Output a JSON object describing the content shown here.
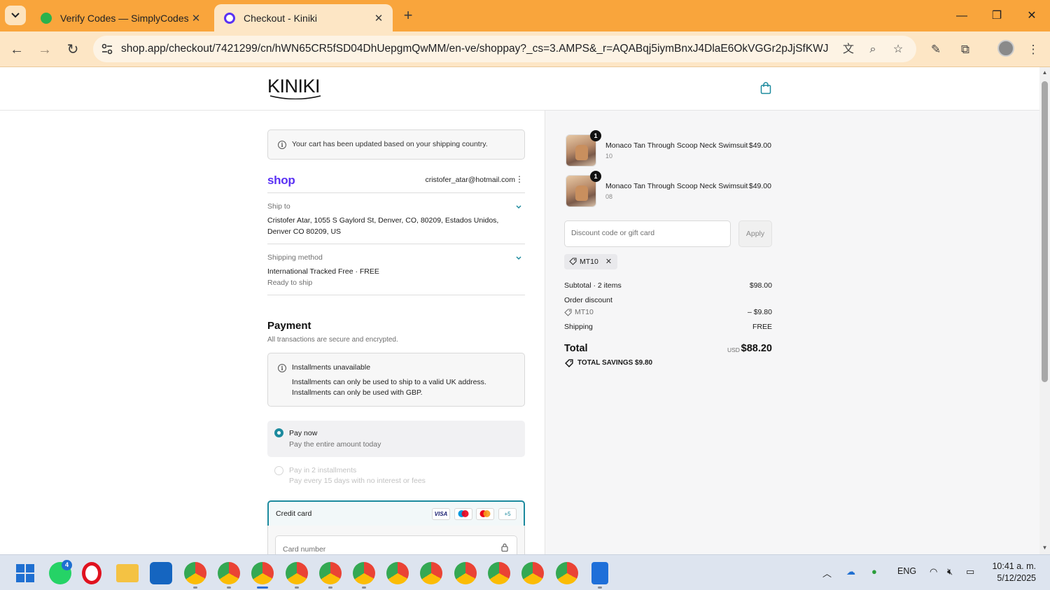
{
  "browser": {
    "tabs": [
      {
        "title": "Verify Codes — SimplyCodes",
        "active": false
      },
      {
        "title": "Checkout - Kiniki",
        "active": true
      }
    ],
    "url": "shop.app/checkout/7421299/cn/hWN65CR5fSD04DhUepgmQwMM/en-ve/shoppay?_cs=3.AMPS&_r=AQABqj5iymBnxJ4DlaE6OkVGGr2pJjSfKWJfZp..."
  },
  "header": {
    "logo": "KINIKI"
  },
  "notice": "Your cart has been updated based on your shipping country.",
  "shop": {
    "brand": "shop",
    "email": "cristofer_atar@hotmail.com"
  },
  "ship_to": {
    "label": "Ship to",
    "line1": "Cristofer Atar, 1055 S Gaylord St, Denver, CO, 80209, Estados Unidos,",
    "line2": "Denver CO 80209, US"
  },
  "shipping_method": {
    "label": "Shipping method",
    "value": "International Tracked Free · FREE",
    "status": "Ready to ship"
  },
  "payment": {
    "title": "Payment",
    "subtitle": "All transactions are secure and encrypted.",
    "installments_title": "Installments unavailable",
    "installments_line1": "Installments can only be used to ship to a valid UK address.",
    "installments_line2": "Installments can only be used with GBP.",
    "options": [
      {
        "title": "Pay now",
        "subtitle": "Pay the entire amount today",
        "selected": true
      },
      {
        "title": "Pay in 2 installments",
        "subtitle": "Pay every 15 days with no interest or fees",
        "selected": false
      }
    ],
    "credit_card_label": "Credit card",
    "card_brands": [
      "VISA",
      "+5"
    ],
    "card_number_placeholder": "Card number"
  },
  "order": {
    "items": [
      {
        "name": "Monaco Tan Through Scoop Neck Swimsuit",
        "variant": "10",
        "price": "$49.00",
        "qty": "1"
      },
      {
        "name": "Monaco Tan Through Scoop Neck Swimsuit",
        "variant": "08",
        "price": "$49.00",
        "qty": "1"
      }
    ],
    "discount_placeholder": "Discount code or gift card",
    "apply_label": "Apply",
    "applied_code": "MT10",
    "subtotal_label": "Subtotal · 2 items",
    "subtotal": "$98.00",
    "order_discount_label": "Order discount",
    "discount_code": "MT10",
    "discount_amount": "– $9.80",
    "shipping_label": "Shipping",
    "shipping_value": "FREE",
    "total_label": "Total",
    "currency": "USD",
    "total": "$88.20",
    "savings": "TOTAL SAVINGS  $9.80"
  },
  "taskbar": {
    "language": "ENG",
    "time": "10:41 a. m.",
    "date": "5/12/2025",
    "whatsapp_badge": "4"
  },
  "colors": {
    "accent": "#1c8a9e",
    "shop_brand": "#5a31f4",
    "browser_frame": "#f9a53c"
  }
}
